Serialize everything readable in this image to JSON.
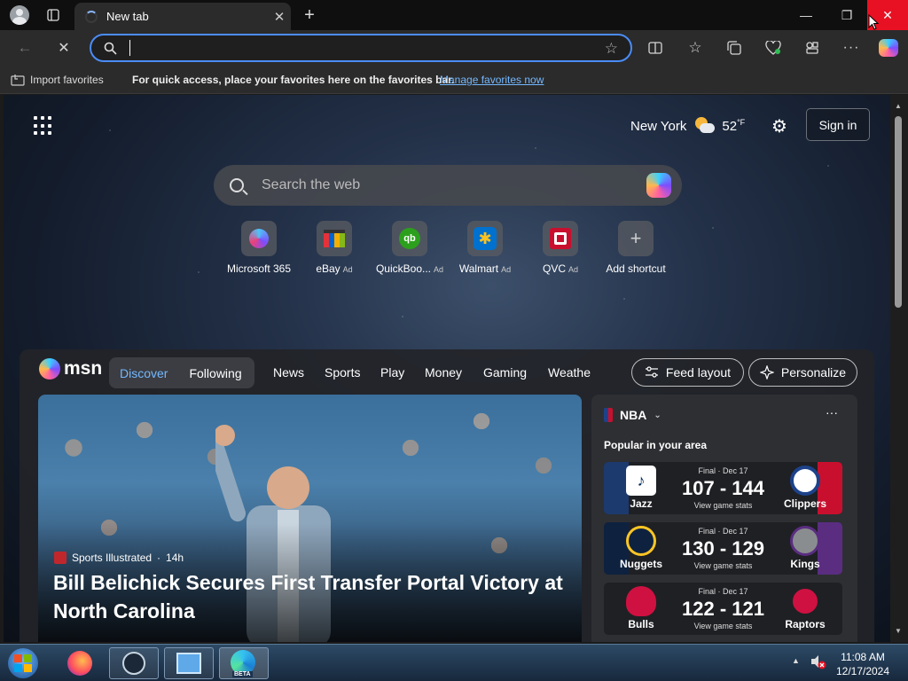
{
  "window": {
    "tab_title": "New tab",
    "tab_close": "✕"
  },
  "window_controls": {
    "minimize": "—",
    "restore": "❐",
    "close": "✕"
  },
  "address_bar": {
    "value": "",
    "placeholder": ""
  },
  "favorites_bar": {
    "import_label": "Import favorites",
    "hint": "For quick access, place your favorites here on the favorites bar.",
    "manage_link": "Manage favorites now"
  },
  "newtab": {
    "weather": {
      "city": "New York",
      "temp": "52",
      "unit": "°F"
    },
    "sign_in": "Sign in",
    "search_placeholder": "Search the web",
    "shortcuts": [
      {
        "label": "Microsoft 365",
        "ad": ""
      },
      {
        "label": "eBay",
        "ad": "Ad"
      },
      {
        "label": "QuickBoo...",
        "ad": "Ad"
      },
      {
        "label": "Walmart",
        "ad": "Ad"
      },
      {
        "label": "QVC",
        "ad": "Ad"
      },
      {
        "label": "Add shortcut",
        "ad": ""
      }
    ]
  },
  "feed": {
    "brand": "msn",
    "toggle": {
      "discover": "Discover",
      "following": "Following"
    },
    "nav": [
      "News",
      "Sports",
      "Play",
      "Money",
      "Gaming",
      "Weathe"
    ],
    "feed_layout": "Feed layout",
    "personalize": "Personalize",
    "hero": {
      "source": "Sports Illustrated",
      "age": "14h",
      "headline": "Bill Belichick Secures First Transfer Portal Victory at North Carolina"
    },
    "nba": {
      "title": "NBA",
      "subtitle": "Popular in your area",
      "more": "···",
      "games": [
        {
          "status": "Final · Dec 17",
          "score": "107 - 144",
          "stats": "View game stats",
          "team_a": "Jazz",
          "team_b": "Clippers",
          "color_a": "#1d3a6e",
          "color_b": "#c8102e"
        },
        {
          "status": "Final · Dec 17",
          "score": "130 - 129",
          "stats": "View game stats",
          "team_a": "Nuggets",
          "team_b": "Kings",
          "color_a": "#0e2240",
          "color_b": "#5a2d81"
        },
        {
          "status": "Final · Dec 17",
          "score": "122 - 121",
          "stats": "View game stats",
          "team_a": "Bulls",
          "team_b": "Raptors",
          "color_a": "#2a2a2a",
          "color_b": "#2a2a2a"
        }
      ]
    }
  },
  "taskbar": {
    "time": "11:08 AM",
    "date": "12/17/2024",
    "beta_label": "BETA"
  },
  "colors": {
    "accent": "#4a8cf7",
    "close_red": "#e81123",
    "link": "#74b8ff"
  }
}
